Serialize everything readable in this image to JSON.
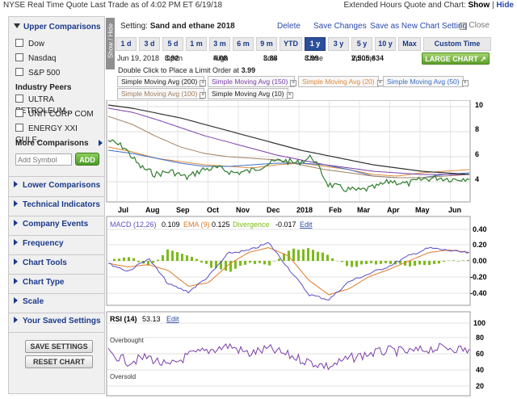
{
  "topbar": {
    "left_text": "NYSE Real Time Quote  Last Trade as of 4:02 PM ET 6/19/18",
    "right_prefix": "Extended Hours Quote and Chart:",
    "show_label": "Show",
    "separator": "|",
    "hide_label": "Hide"
  },
  "sidebar": {
    "upper_comparisons": "Upper Comparisons",
    "indices": [
      "Dow",
      "Nasdaq",
      "S&P 500"
    ],
    "industry_peers_title": "Industry Peers",
    "peers": [
      "ULTRA PETROLEUM...",
      "UNIT CORP COM",
      "ENERGY XXI GULF..."
    ],
    "more_comparisons": "More Comparisons",
    "add_symbol_placeholder": "Add Symbol",
    "add_button": "ADD",
    "sections": [
      "Lower Comparisons",
      "Technical Indicators",
      "Company Events",
      "Frequency",
      "Chart Tools",
      "Chart Type",
      "Scale",
      "Your Saved Settings"
    ],
    "save_settings": "SAVE SETTINGS",
    "reset_chart": "RESET CHART"
  },
  "strip_label": "Show / Hide",
  "header": {
    "setting_label": "Setting:",
    "setting_name": "Sand and ethane 2018",
    "delete": "Delete",
    "save_changes": "Save Changes",
    "save_as_new": "Save as New Chart Setting",
    "close": "Close",
    "close_glyph": "×"
  },
  "periods": [
    "1 d",
    "3 d",
    "5 d",
    "1 m",
    "3 m",
    "6 m",
    "9 m",
    "YTD",
    "1 y",
    "3 y",
    "5 y",
    "10 y",
    "Max",
    "Custom Time Period"
  ],
  "active_period": "1 y",
  "quote": {
    "date": "Jun 19, 2018",
    "open_label": "Open",
    "open": "3.92",
    "high_label": "High",
    "high": "4.08",
    "low_label": "Low",
    "low": "3.88",
    "close_label": "Close",
    "close": "3.99",
    "volume_label": "Volume",
    "volume": "2,505,634",
    "limit_text": "Double Click to Place a Limit Order at",
    "limit_value": "3.99",
    "large_chart": "LARGE CHART ↗"
  },
  "indicators": [
    {
      "label": "Simple Moving Avg (200)",
      "color": "#333333"
    },
    {
      "label": "Simple Moving Avg (150)",
      "color": "#7b3fa8"
    },
    {
      "label": "Simple Moving Avg (20)",
      "color": "#e08a3c"
    },
    {
      "label": "Simple Moving Avg (50)",
      "color": "#3a6fc4"
    },
    {
      "label": "Simple Moving Avg (100)",
      "color": "#a08060"
    },
    {
      "label": "Simple Moving Avg (10)",
      "color": "#333333"
    }
  ],
  "colors": {
    "price": "#2e7d2e",
    "sma200": "#333333",
    "sma150": "#7b3fa8",
    "sma100": "#a08060",
    "sma50": "#3a6fc4",
    "sma20": "#e08a3c",
    "macd": "#5b4fc2",
    "signal": "#e07a2a",
    "divergence": "#7cbb1a",
    "rsi": "#7b3fa8",
    "active_period": "#2c4f9c"
  },
  "price_axis": [
    "10",
    "8",
    "6",
    "4"
  ],
  "months": [
    "Jul",
    "Aug",
    "Sep",
    "Oct",
    "Nov",
    "Dec",
    "2018",
    "Feb",
    "Mar",
    "Apr",
    "May",
    "Jun"
  ],
  "macd_legend": {
    "macd_label": "MACD (12,26)",
    "macd_value": "0.109",
    "ema_label": "EMA (9)",
    "ema_value": "0.125",
    "div_label": "Divergence",
    "div_value": "-0.017",
    "edit": "Edit"
  },
  "macd_axis": [
    "0.40",
    "0.20",
    "0.00",
    "-0.20",
    "-0.40"
  ],
  "rsi_legend": {
    "label": "RSI (14)",
    "value": "53.13",
    "edit": "Edit"
  },
  "rsi_axis": [
    "100",
    "80",
    "60",
    "40",
    "20"
  ],
  "rsi_overbought": "Overbought",
  "rsi_oversold": "Oversold"
}
